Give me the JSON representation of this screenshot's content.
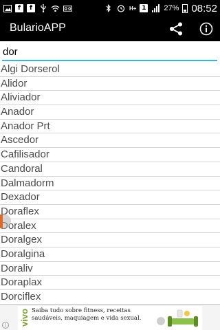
{
  "status_bar": {
    "battery_percent": "27%",
    "time": "08:52",
    "notification_count": "1",
    "network_label": "H+",
    "left_icons": [
      "image-icon",
      "facebook-icon",
      "facebook-icon",
      "usb-icon",
      "wifi-icon",
      "voicemail-icon"
    ],
    "right_icons": [
      "bluetooth-icon",
      "alarm-icon",
      "signal-icon",
      "battery-icon"
    ]
  },
  "action_bar": {
    "title": "BularioAPP",
    "share_icon": "share-icon",
    "info_icon": "info-icon"
  },
  "search": {
    "value": "dor",
    "accent_color": "#33b5e5"
  },
  "results": [
    "Algi Dorserol",
    "Alidor",
    "Aliviador",
    "Anador",
    "Anador Prt",
    "Ascedor",
    "Cafilisador",
    "Candoral",
    "Dalmadorm",
    "Dexador",
    "Doraflex",
    "Doralex",
    "Doralgex",
    "Doralgina",
    "Doraliv",
    "Doraplax",
    "Dorciflex"
  ],
  "ad": {
    "brand": "vivo",
    "line1": "Saiba tudo sobre fitness, receitas",
    "line2": "saudáveis, maquiagem e vida sexual.",
    "brand_color": "#7aa328"
  }
}
